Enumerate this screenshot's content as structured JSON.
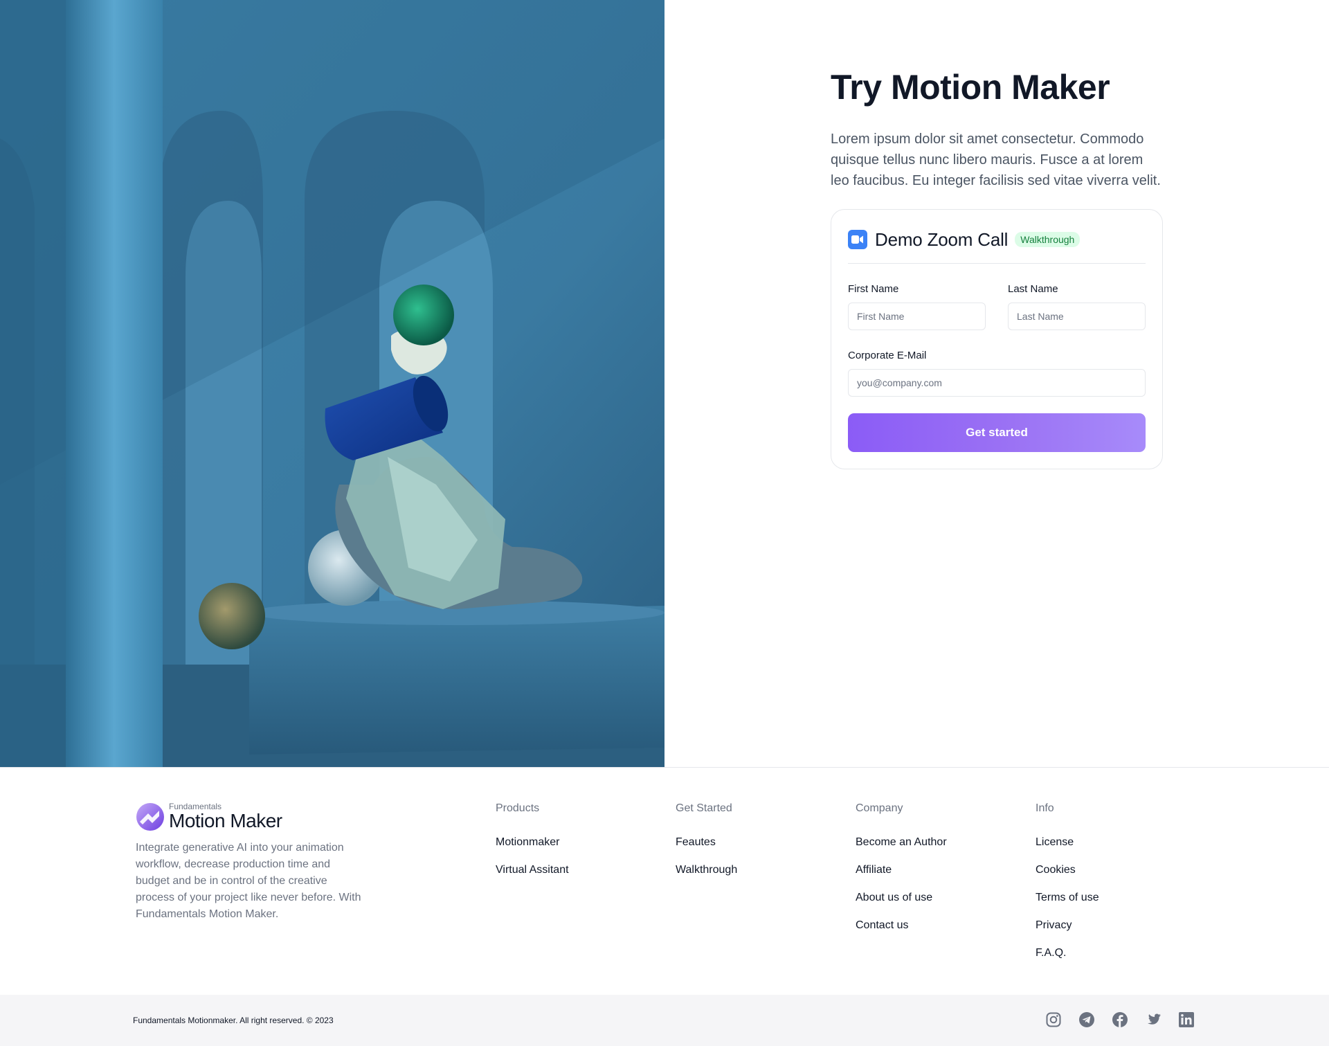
{
  "hero": {
    "title": "Try Motion Maker",
    "description": "Lorem ipsum dolor sit amet consectetur. Commodo quisque tellus nunc libero mauris. Fusce a at lorem leo faucibus. Eu integer facilisis sed vitae viverra velit."
  },
  "form": {
    "card_title": "Demo Zoom Call",
    "badge": "Walkthrough",
    "first_name_label": "First Name",
    "first_name_placeholder": "First Name",
    "last_name_label": "Last Name",
    "last_name_placeholder": "Last Name",
    "email_label": "Corporate E-Mail",
    "email_placeholder": "you@company.com",
    "submit_label": "Get started"
  },
  "footer": {
    "brand_small": "Fundamentals",
    "brand_name": "Motion Maker",
    "brand_description": "Integrate generative AI into your animation workflow, decrease production time and budget and be in control of the creative process of your project like never before. With Fundamentals Motion Maker.",
    "columns": [
      {
        "heading": "Products",
        "links": [
          "Motionmaker",
          "Virtual Assitant"
        ]
      },
      {
        "heading": "Get Started",
        "links": [
          "Feautes",
          "Walkthrough"
        ]
      },
      {
        "heading": "Company",
        "links": [
          "Become an Author",
          "Affiliate",
          "About us of use",
          "Contact us"
        ]
      },
      {
        "heading": "Info",
        "links": [
          "License",
          "Cookies",
          "Terms of use",
          "Privacy",
          "F.A.Q."
        ]
      }
    ],
    "copyright": "Fundamentals Motionmaker. All right reserved. © 2023",
    "socials": [
      "instagram-icon",
      "telegram-icon",
      "facebook-icon",
      "twitter-icon",
      "linkedin-icon"
    ]
  },
  "colors": {
    "accent": "#8b5cf6",
    "badge_bg": "#dcfce7",
    "badge_text": "#15803d",
    "zoom_blue": "#3b82f6"
  }
}
